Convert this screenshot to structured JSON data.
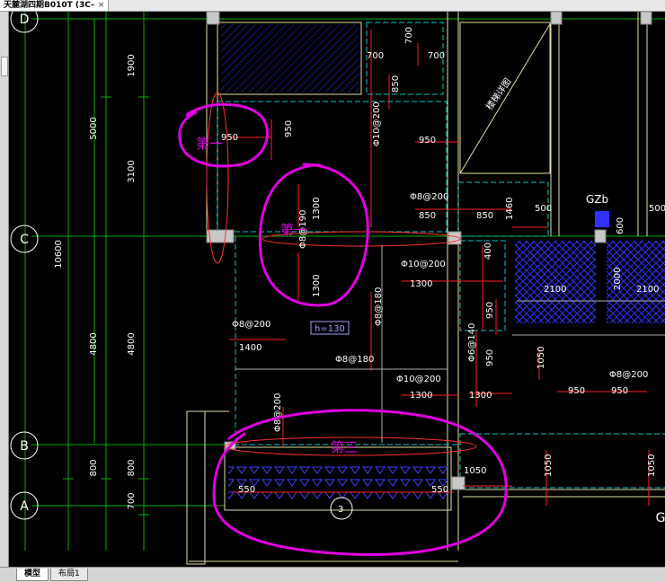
{
  "document_tab": {
    "title": "天麓湖四期B010T (3C-",
    "close": "×"
  },
  "axes": {
    "d": "D",
    "c": "C",
    "b": "B",
    "a": "A",
    "g": "G"
  },
  "left_dims": {
    "d1900": "1900",
    "d5000": "5000",
    "d3100": "3100",
    "d10600": "10600",
    "d4800a": "4800",
    "d4800b": "4800",
    "d800a": "800",
    "d800b": "800",
    "d700": "700"
  },
  "labels": {
    "t700a": "700",
    "t700b": "700",
    "t700c": "700",
    "t850a": "850",
    "t950a": "950",
    "t950b": "950",
    "phi10_200a": "Φ10@200",
    "t950c": "950",
    "slab_note": "楼梯详图",
    "phi8_200a": "Φ8@200",
    "t850b": "850",
    "t850c": "850",
    "t1460": "1460",
    "t500a": "500",
    "t500b": "500",
    "gz": "GZb",
    "t600": "600",
    "t1300a": "1300",
    "phi8_190": "Φ8@190",
    "t1300b": "1300",
    "phi10_200b": "Φ10@200",
    "t1300c": "1300",
    "t400": "400",
    "t2100a": "2100",
    "t2000": "2000",
    "t2100b": "2100",
    "t950d": "950",
    "phi8_180a": "Φ8@180",
    "phi8_200b": "Φ8@200",
    "h130": "h=130",
    "t1400": "1400",
    "phi6_140": "Φ6@140",
    "t950e": "950",
    "t1050a": "1050",
    "phi8_180b": "Φ8@180",
    "phi8_200c": "Φ8@200",
    "phi10_200c": "Φ10@200",
    "t1300d": "1300",
    "t1300e": "1300",
    "t950f": "950",
    "t950g": "950",
    "phi8_200d": "Φ8@200",
    "t1050b": "1050",
    "t1050c": "1050",
    "t1050d": "1050",
    "t550a": "550",
    "t550b": "550",
    "t3": "3"
  },
  "annotations": {
    "first_a": "第一",
    "first_b": "第一",
    "third": "第三"
  },
  "layout_tabs": {
    "model": "模型",
    "layout1": "布局1"
  },
  "colors": {
    "background": "#000000",
    "grid_line": "#00c000",
    "axis_bubble": "#ffffff",
    "dim_text": "#ffffff",
    "rebar": "#ff0000",
    "hatch": "#3030ff",
    "markup": "#e000e0",
    "cyan": "#00c8c8",
    "wall": "#e0e0a0"
  }
}
